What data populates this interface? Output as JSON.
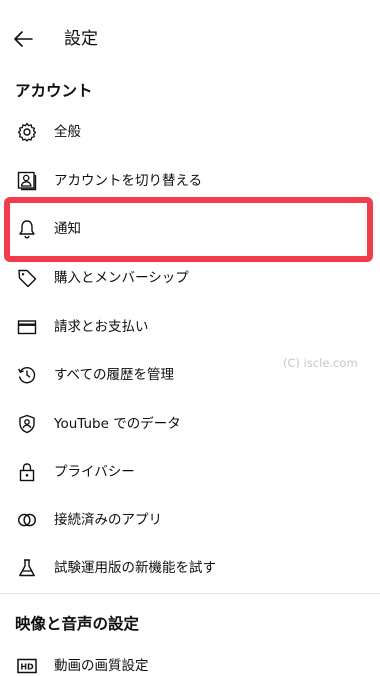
{
  "header": {
    "title": "設定"
  },
  "sections": {
    "account": {
      "title": "アカウント"
    },
    "video_audio": {
      "title": "映像と音声の設定"
    }
  },
  "menu": [
    {
      "label": "全般",
      "icon": "gear-icon"
    },
    {
      "label": "アカウントを切り替える",
      "icon": "switch-account-icon"
    },
    {
      "label": "通知",
      "icon": "bell-icon"
    },
    {
      "label": "購入とメンバーシップ",
      "icon": "tag-icon"
    },
    {
      "label": "請求とお支払い",
      "icon": "credit-card-icon"
    },
    {
      "label": "すべての履歴を管理",
      "icon": "history-icon"
    },
    {
      "label": "YouTube でのデータ",
      "icon": "shield-user-icon"
    },
    {
      "label": "プライバシー",
      "icon": "lock-icon"
    },
    {
      "label": "接続済みのアプリ",
      "icon": "linked-circles-icon"
    },
    {
      "label": "試験運用版の新機能を試す",
      "icon": "flask-icon"
    },
    {
      "label": "動画の画質設定",
      "icon": "hd-icon"
    }
  ],
  "highlight_color": "#f03c4b",
  "watermark": "(C) iscle.com"
}
